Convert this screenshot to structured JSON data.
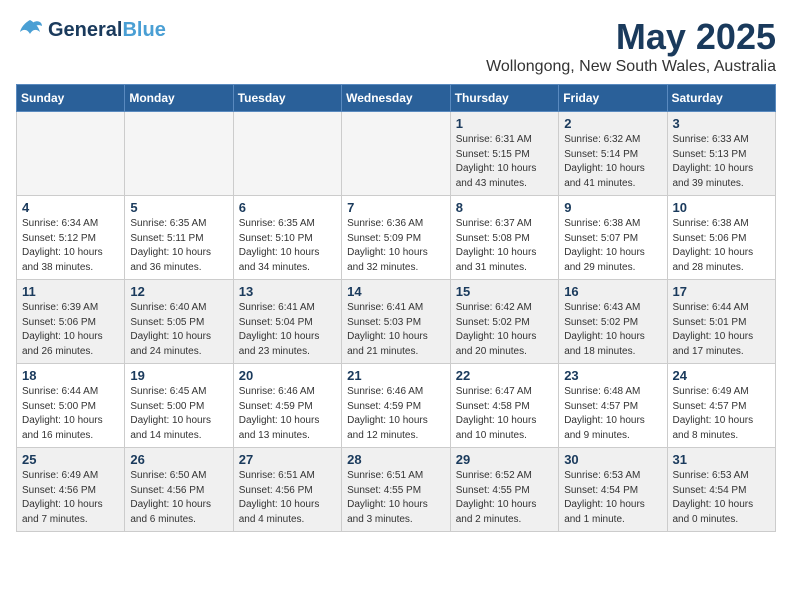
{
  "header": {
    "logo_general": "General",
    "logo_blue": "Blue",
    "month": "May 2025",
    "location": "Wollongong, New South Wales, Australia"
  },
  "days_of_week": [
    "Sunday",
    "Monday",
    "Tuesday",
    "Wednesday",
    "Thursday",
    "Friday",
    "Saturday"
  ],
  "weeks": [
    [
      {
        "day": "",
        "empty": true
      },
      {
        "day": "",
        "empty": true
      },
      {
        "day": "",
        "empty": true
      },
      {
        "day": "",
        "empty": true
      },
      {
        "day": "1",
        "sunrise": "6:31 AM",
        "sunset": "5:15 PM",
        "daylight": "10 hours and 43 minutes."
      },
      {
        "day": "2",
        "sunrise": "6:32 AM",
        "sunset": "5:14 PM",
        "daylight": "10 hours and 41 minutes."
      },
      {
        "day": "3",
        "sunrise": "6:33 AM",
        "sunset": "5:13 PM",
        "daylight": "10 hours and 39 minutes."
      }
    ],
    [
      {
        "day": "4",
        "sunrise": "6:34 AM",
        "sunset": "5:12 PM",
        "daylight": "10 hours and 38 minutes."
      },
      {
        "day": "5",
        "sunrise": "6:35 AM",
        "sunset": "5:11 PM",
        "daylight": "10 hours and 36 minutes."
      },
      {
        "day": "6",
        "sunrise": "6:35 AM",
        "sunset": "5:10 PM",
        "daylight": "10 hours and 34 minutes."
      },
      {
        "day": "7",
        "sunrise": "6:36 AM",
        "sunset": "5:09 PM",
        "daylight": "10 hours and 32 minutes."
      },
      {
        "day": "8",
        "sunrise": "6:37 AM",
        "sunset": "5:08 PM",
        "daylight": "10 hours and 31 minutes."
      },
      {
        "day": "9",
        "sunrise": "6:38 AM",
        "sunset": "5:07 PM",
        "daylight": "10 hours and 29 minutes."
      },
      {
        "day": "10",
        "sunrise": "6:38 AM",
        "sunset": "5:06 PM",
        "daylight": "10 hours and 28 minutes."
      }
    ],
    [
      {
        "day": "11",
        "sunrise": "6:39 AM",
        "sunset": "5:06 PM",
        "daylight": "10 hours and 26 minutes."
      },
      {
        "day": "12",
        "sunrise": "6:40 AM",
        "sunset": "5:05 PM",
        "daylight": "10 hours and 24 minutes."
      },
      {
        "day": "13",
        "sunrise": "6:41 AM",
        "sunset": "5:04 PM",
        "daylight": "10 hours and 23 minutes."
      },
      {
        "day": "14",
        "sunrise": "6:41 AM",
        "sunset": "5:03 PM",
        "daylight": "10 hours and 21 minutes."
      },
      {
        "day": "15",
        "sunrise": "6:42 AM",
        "sunset": "5:02 PM",
        "daylight": "10 hours and 20 minutes."
      },
      {
        "day": "16",
        "sunrise": "6:43 AM",
        "sunset": "5:02 PM",
        "daylight": "10 hours and 18 minutes."
      },
      {
        "day": "17",
        "sunrise": "6:44 AM",
        "sunset": "5:01 PM",
        "daylight": "10 hours and 17 minutes."
      }
    ],
    [
      {
        "day": "18",
        "sunrise": "6:44 AM",
        "sunset": "5:00 PM",
        "daylight": "10 hours and 16 minutes."
      },
      {
        "day": "19",
        "sunrise": "6:45 AM",
        "sunset": "5:00 PM",
        "daylight": "10 hours and 14 minutes."
      },
      {
        "day": "20",
        "sunrise": "6:46 AM",
        "sunset": "4:59 PM",
        "daylight": "10 hours and 13 minutes."
      },
      {
        "day": "21",
        "sunrise": "6:46 AM",
        "sunset": "4:59 PM",
        "daylight": "10 hours and 12 minutes."
      },
      {
        "day": "22",
        "sunrise": "6:47 AM",
        "sunset": "4:58 PM",
        "daylight": "10 hours and 10 minutes."
      },
      {
        "day": "23",
        "sunrise": "6:48 AM",
        "sunset": "4:57 PM",
        "daylight": "10 hours and 9 minutes."
      },
      {
        "day": "24",
        "sunrise": "6:49 AM",
        "sunset": "4:57 PM",
        "daylight": "10 hours and 8 minutes."
      }
    ],
    [
      {
        "day": "25",
        "sunrise": "6:49 AM",
        "sunset": "4:56 PM",
        "daylight": "10 hours and 7 minutes."
      },
      {
        "day": "26",
        "sunrise": "6:50 AM",
        "sunset": "4:56 PM",
        "daylight": "10 hours and 6 minutes."
      },
      {
        "day": "27",
        "sunrise": "6:51 AM",
        "sunset": "4:56 PM",
        "daylight": "10 hours and 4 minutes."
      },
      {
        "day": "28",
        "sunrise": "6:51 AM",
        "sunset": "4:55 PM",
        "daylight": "10 hours and 3 minutes."
      },
      {
        "day": "29",
        "sunrise": "6:52 AM",
        "sunset": "4:55 PM",
        "daylight": "10 hours and 2 minutes."
      },
      {
        "day": "30",
        "sunrise": "6:53 AM",
        "sunset": "4:54 PM",
        "daylight": "10 hours and 1 minute."
      },
      {
        "day": "31",
        "sunrise": "6:53 AM",
        "sunset": "4:54 PM",
        "daylight": "10 hours and 0 minutes."
      }
    ]
  ]
}
